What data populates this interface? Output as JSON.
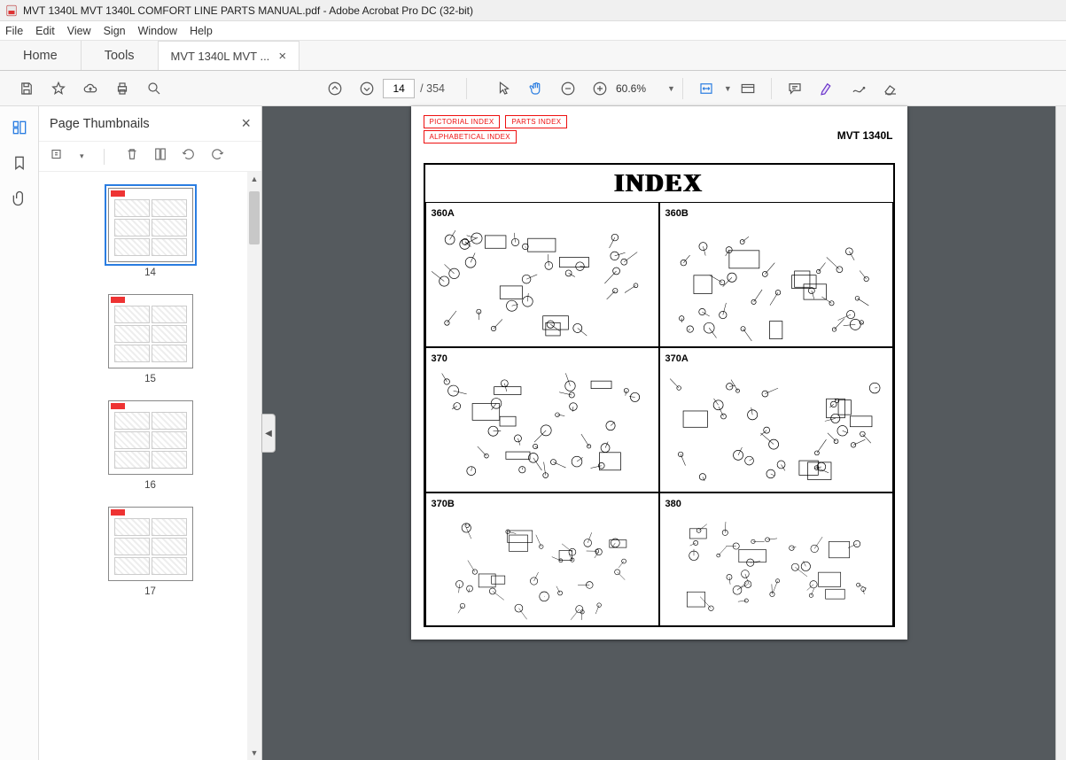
{
  "app": {
    "title": "MVT 1340L  MVT 1340L COMFORT LINE PARTS MANUAL.pdf - Adobe Acrobat Pro DC (32-bit)"
  },
  "menu": {
    "file": "File",
    "edit": "Edit",
    "view": "View",
    "sign": "Sign",
    "window": "Window",
    "help": "Help"
  },
  "tabs": {
    "home": "Home",
    "tools": "Tools",
    "doc": "MVT 1340L  MVT ..."
  },
  "toolbar": {
    "page_value": "14",
    "page_count": "/ 354",
    "zoom": "60.6%"
  },
  "thumbnails": {
    "title": "Page Thumbnails",
    "items": [
      {
        "label": "14",
        "selected": true
      },
      {
        "label": "15",
        "selected": false
      },
      {
        "label": "16",
        "selected": false
      },
      {
        "label": "17",
        "selected": false
      }
    ]
  },
  "document": {
    "links": {
      "pictorial": "PICTORIAL INDEX",
      "parts": "PARTS INDEX",
      "alpha": "ALPHABETICAL INDEX"
    },
    "model": "MVT 1340L",
    "index_title": "INDEX",
    "cells": [
      "360A",
      "360B",
      "370",
      "370A",
      "370B",
      "380"
    ]
  }
}
